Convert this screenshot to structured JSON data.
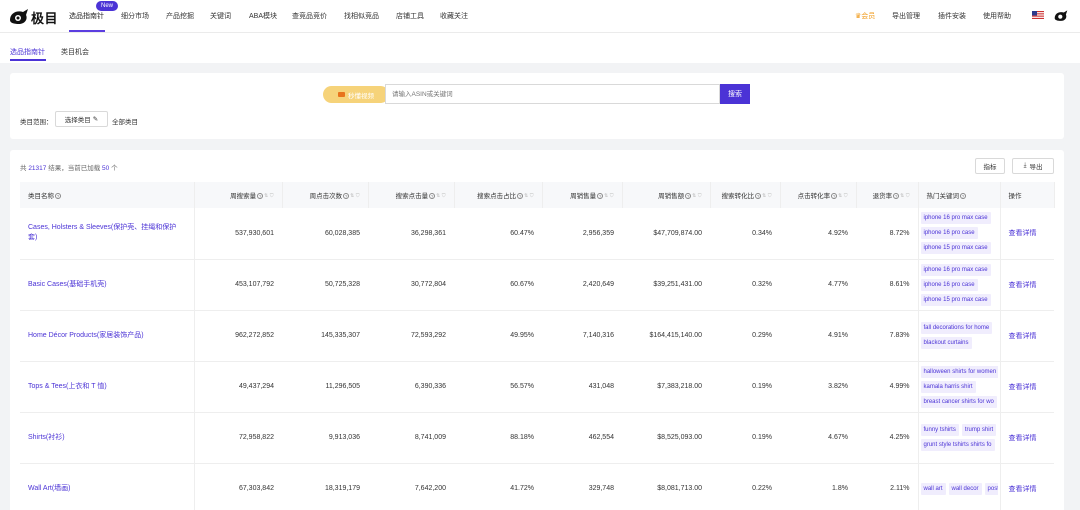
{
  "nav": {
    "logo_text": "极目",
    "items": [
      "选品指南针",
      "细分市场",
      "产品挖掘",
      "关键词",
      "ABA模块",
      "查竞品竞价",
      "找相似竞品",
      "店铺工具",
      "收藏关注"
    ],
    "new_badge": "New",
    "right_items": [
      "会员",
      "导出管理",
      "插件安装",
      "使用帮助"
    ]
  },
  "subtabs": [
    "选品指南针",
    "类目机会"
  ],
  "search": {
    "video_label": "秒懂视频",
    "placeholder": "请输入ASIN或关键词",
    "button": "搜索",
    "category_label": "类目范围：",
    "category_select": "选择类目",
    "category_all": "全部类目"
  },
  "results": {
    "summary_prefix": "共",
    "total": "21317",
    "summary_mid": "结果，当前已加载",
    "loaded": "50",
    "summary_suffix": "个",
    "metric_button": "指标",
    "export_button": "导出"
  },
  "table": {
    "headers": [
      "类目名称",
      "周搜索量",
      "周点击次数",
      "搜索点击量",
      "搜索点击占比",
      "周销售量",
      "周销售额",
      "搜索转化比",
      "点击转化率",
      "退货率",
      "热门关键词",
      "操作"
    ],
    "action_label": "查看详情",
    "rows": [
      {
        "name": "Cases, Holsters & Sleeves(保护壳、挂绳和保护套)",
        "c1": "537,930,601",
        "c2": "60,028,385",
        "c3": "36,298,361",
        "c4": "60.47%",
        "c5": "2,956,359",
        "c6": "$47,709,874.00",
        "c7": "0.34%",
        "c8": "4.92%",
        "c9": "8.72%",
        "kw": [
          [
            "iphone 16 pro max case"
          ],
          [
            "iphone 16 pro case"
          ],
          [
            "iphone 15 pro max case"
          ]
        ]
      },
      {
        "name": "Basic Cases(基础手机壳)",
        "c1": "453,107,792",
        "c2": "50,725,328",
        "c3": "30,772,804",
        "c4": "60.67%",
        "c5": "2,420,649",
        "c6": "$39,251,431.00",
        "c7": "0.32%",
        "c8": "4.77%",
        "c9": "8.61%",
        "kw": [
          [
            "iphone 16 pro max case"
          ],
          [
            "iphone 16 pro case"
          ],
          [
            "iphone 15 pro max case"
          ]
        ]
      },
      {
        "name": "Home Décor Products(家居装饰产品)",
        "c1": "962,272,852",
        "c2": "145,335,307",
        "c3": "72,593,292",
        "c4": "49.95%",
        "c5": "7,140,316",
        "c6": "$164,415,140.00",
        "c7": "0.29%",
        "c8": "4.91%",
        "c9": "7.83%",
        "kw": [
          [
            "fall decorations for home"
          ],
          [
            "blackout curtains"
          ]
        ]
      },
      {
        "name": "Tops & Tees(上衣和 T 恤)",
        "c1": "49,437,294",
        "c2": "11,296,505",
        "c3": "6,390,336",
        "c4": "56.57%",
        "c5": "431,048",
        "c6": "$7,383,218.00",
        "c7": "0.19%",
        "c8": "3.82%",
        "c9": "4.99%",
        "kw": [
          [
            "halloween shirts for women"
          ],
          [
            "kamala harris shirt"
          ],
          [
            "breast cancer shirts for wo"
          ]
        ]
      },
      {
        "name": "Shirts(衬衫)",
        "c1": "72,958,822",
        "c2": "9,913,036",
        "c3": "8,741,009",
        "c4": "88.18%",
        "c5": "462,554",
        "c6": "$8,525,093.00",
        "c7": "0.19%",
        "c8": "4.67%",
        "c9": "4.25%",
        "kw": [
          [
            "funny tshirts",
            "trump shirt"
          ],
          [
            "grunt style tshirts shirts fo"
          ]
        ]
      },
      {
        "name": "Wall Art(墙画)",
        "c1": "67,303,842",
        "c2": "18,319,179",
        "c3": "7,642,200",
        "c4": "41.72%",
        "c5": "329,748",
        "c6": "$8,081,713.00",
        "c7": "0.22%",
        "c8": "1.8%",
        "c9": "2.11%",
        "kw": [
          [
            "wall art",
            "wall decor",
            "post"
          ]
        ]
      }
    ]
  },
  "colors": {
    "accent": "#4b33d6",
    "vip": "#f09a1a",
    "video": "#f6d37a"
  }
}
